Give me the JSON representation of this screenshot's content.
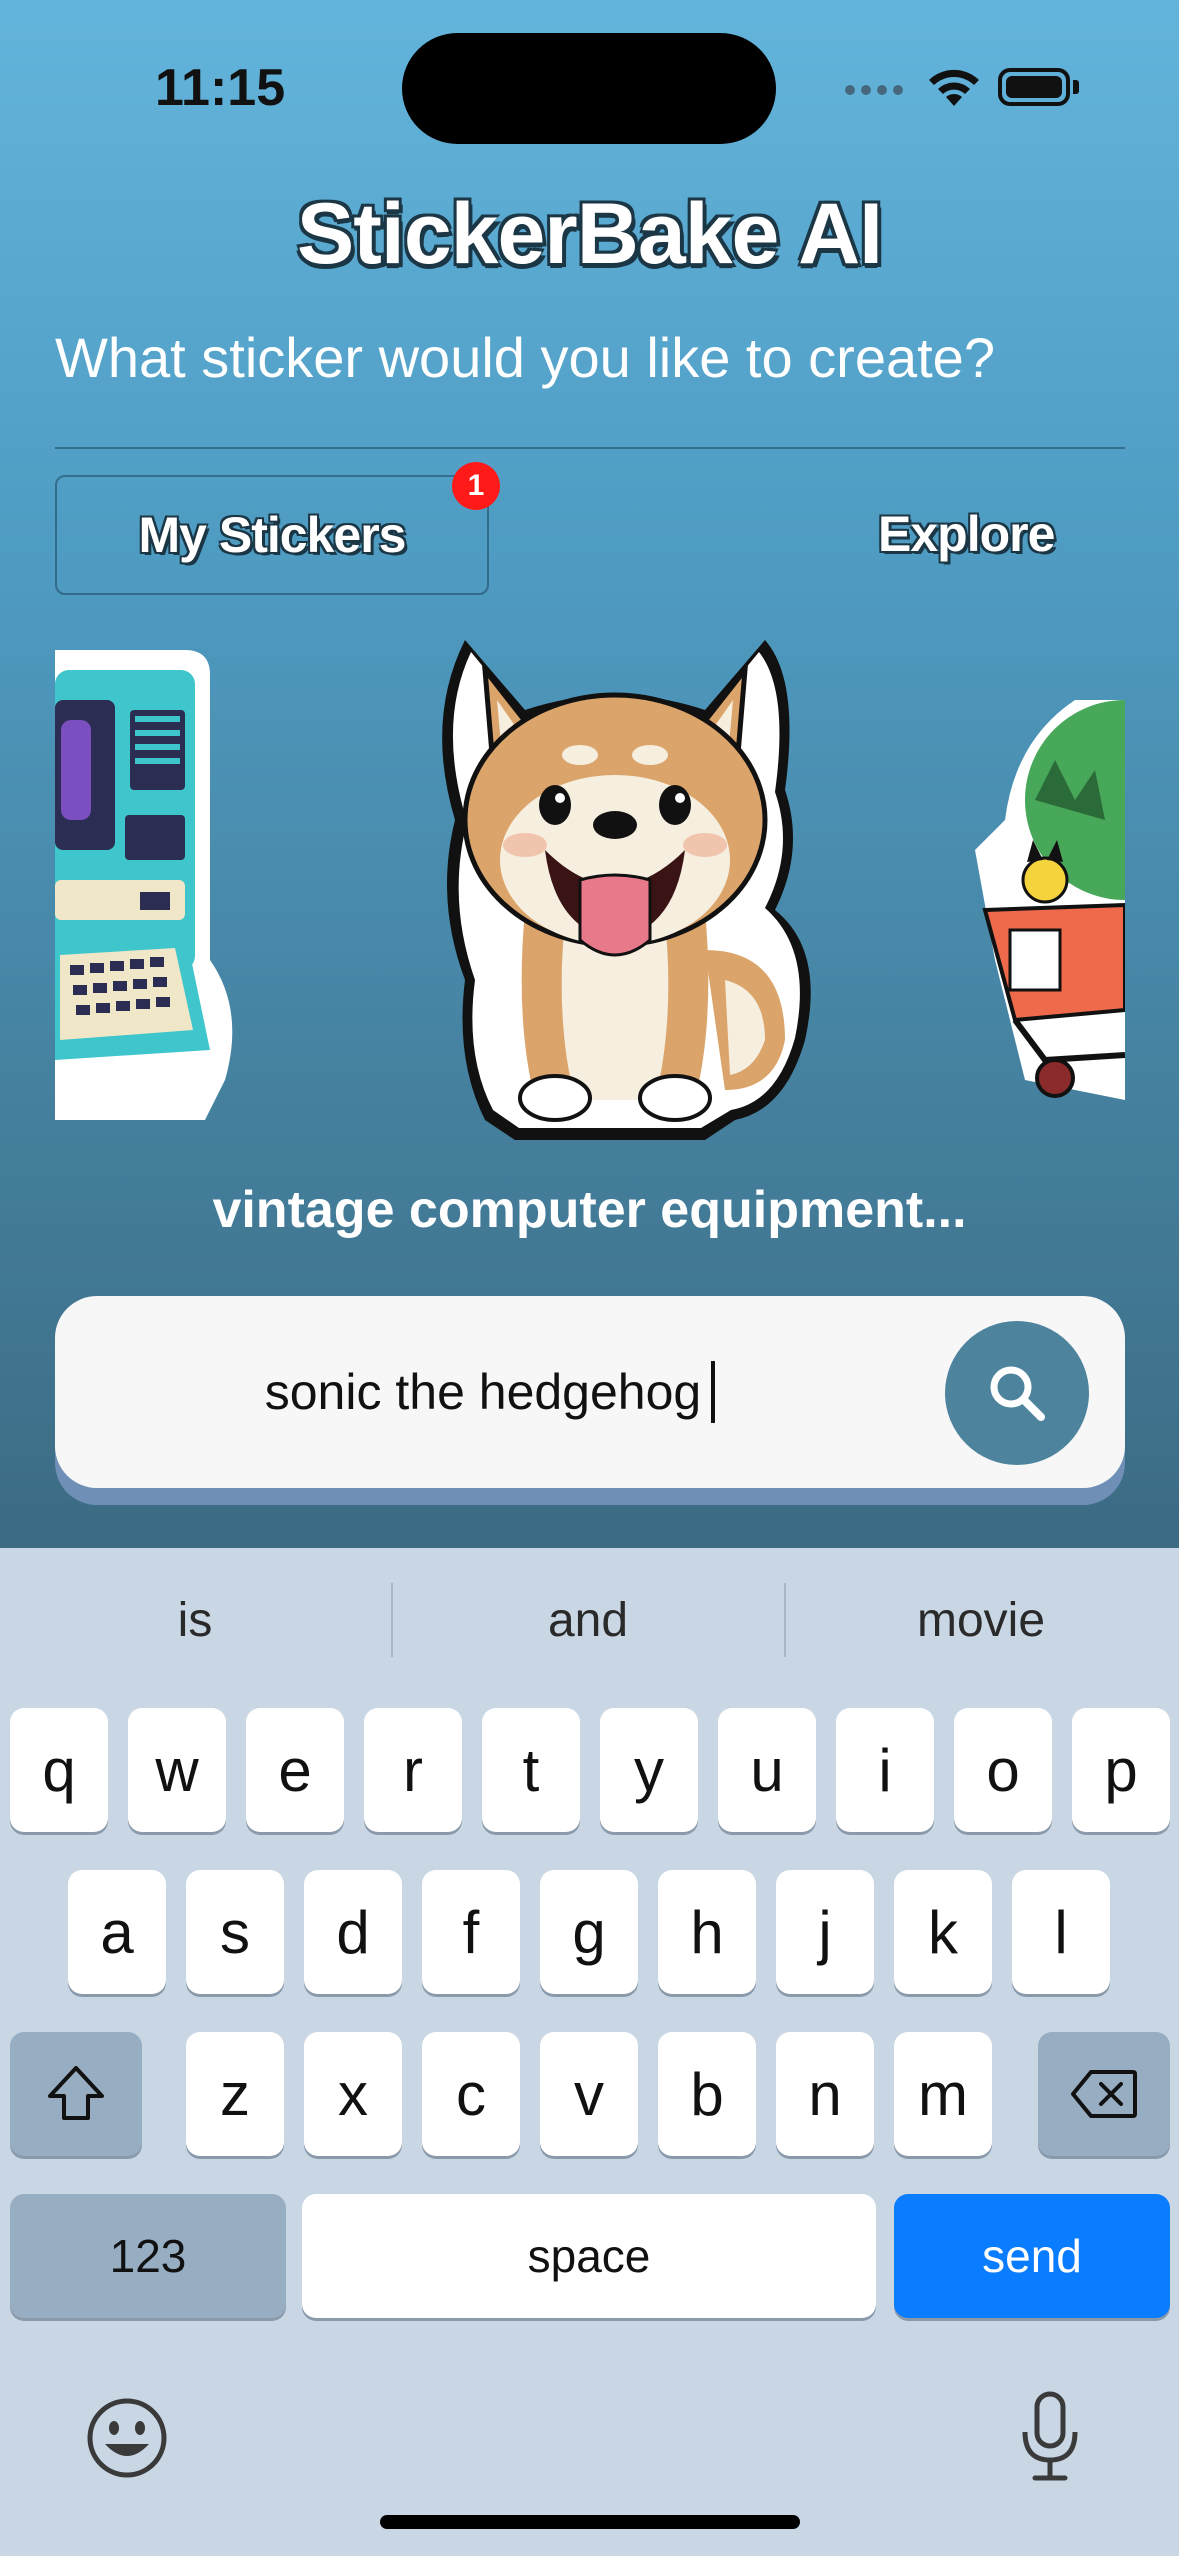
{
  "status_bar": {
    "time": "11:15"
  },
  "app": {
    "title": "StickerBake AI",
    "subtitle": "What sticker would you like to create?",
    "tabs": {
      "my_stickers": "My Stickers",
      "explore": "Explore",
      "badge_count": "1"
    },
    "carousel": {
      "items": [
        "vintage-computer-sticker",
        "shiba-inu-dog-sticker",
        "shopping-cart-sticker"
      ],
      "caption": "vintage computer equipment..."
    },
    "search": {
      "value": "sonic the hedgehog"
    }
  },
  "keyboard": {
    "suggestions": [
      "is",
      "and",
      "movie"
    ],
    "row1": [
      "q",
      "w",
      "e",
      "r",
      "t",
      "y",
      "u",
      "i",
      "o",
      "p"
    ],
    "row2": [
      "a",
      "s",
      "d",
      "f",
      "g",
      "h",
      "j",
      "k",
      "l"
    ],
    "row3": [
      "z",
      "x",
      "c",
      "v",
      "b",
      "n",
      "m"
    ],
    "numbers_key": "123",
    "space_key": "space",
    "send_key": "send"
  }
}
